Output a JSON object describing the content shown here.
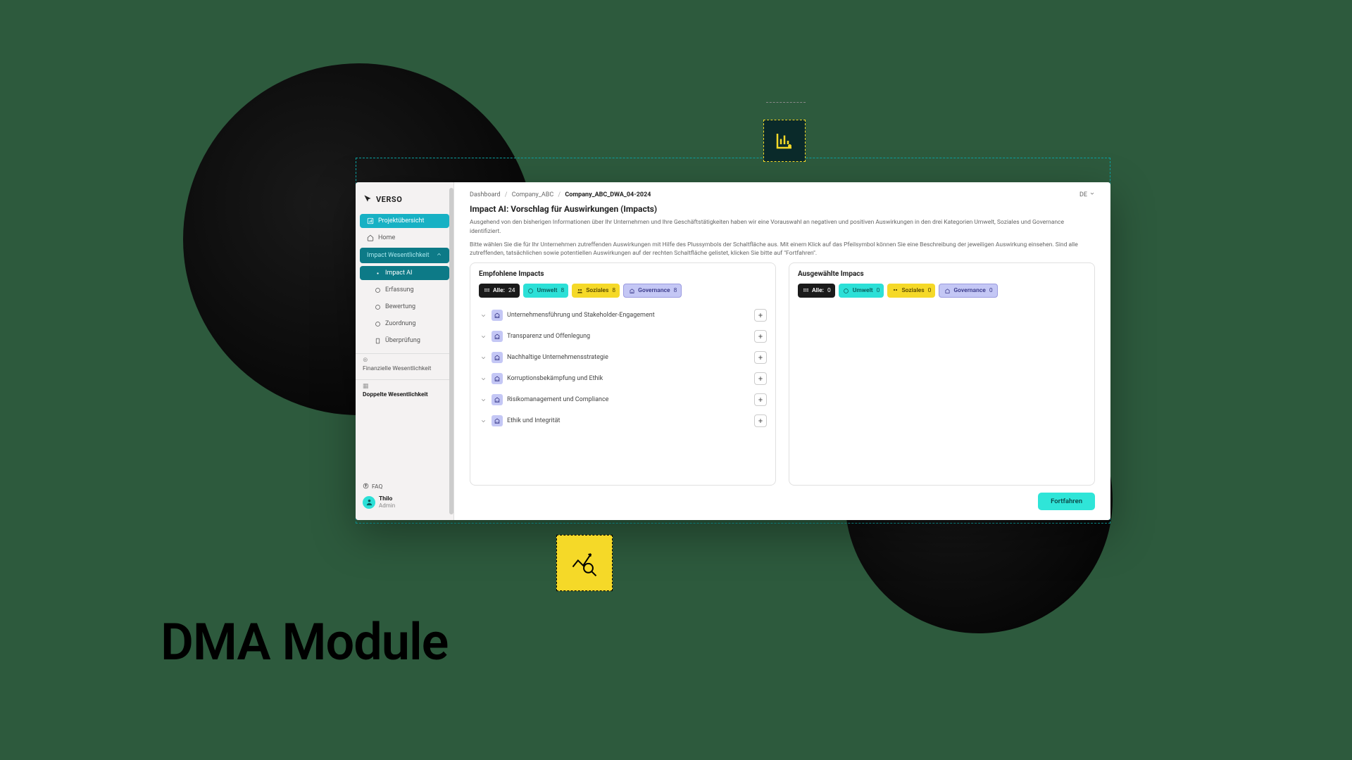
{
  "marketing_title": "DMA Module",
  "logo_text": "VERSO",
  "breadcrumbs": {
    "items": [
      "Dashboard",
      "Company_ABC",
      "Company_ABC_DWA_04-2024"
    ]
  },
  "language": "DE",
  "sidebar": {
    "projektubersicht": "Projektübersicht",
    "home": "Home",
    "impact_group": "Impact Wesentlichkeit",
    "impact_ai": "Impact AI",
    "erfassung": "Erfassung",
    "bewertung": "Bewertung",
    "zuordnung": "Zuordnung",
    "uberprufung": "Überprüfung",
    "fin_section": "Finanzielle Wesentlichkeit",
    "dopp_section": "Doppelte Wesentlichkeit",
    "faq": "FAQ",
    "user_name": "Thilo",
    "user_role": "Admin"
  },
  "page": {
    "title": "Impact AI: Vorschlag für Auswirkungen (Impacts)",
    "desc1": "Ausgehend von den bisherigen Informationen über Ihr Unternehmen und Ihre Geschäftstätigkeiten haben wir eine Vorauswahl an negativen und positiven Auswirkungen in den drei Kategorien Umwelt, Soziales und Governance identifiziert.",
    "desc2": "Bitte wählen Sie die für Ihr Unternehmen zutreffenden Auswirkungen mit Hilfe des Plussymbols der Schaltfläche aus. Mit einem Klick auf das Pfeilsymbol können Sie eine Beschreibung der jeweiligen Auswirkung einsehen. Sind alle zutreffenden, tatsächlichen sowie potentiellen Auswirkungen auf der rechten Schaltfläche gelistet, klicken Sie bitte auf \"Fortfahren\"."
  },
  "panels": {
    "left_title": "Empfohlene Impacts",
    "right_title": "Ausgewählte Impacs",
    "filters_left": {
      "all_label": "Alle:",
      "all_count": "24",
      "env_label": "Umwelt",
      "env_count": "8",
      "soc_label": "Soziales",
      "soc_count": "8",
      "gov_label": "Governance",
      "gov_count": "8"
    },
    "filters_right": {
      "all_label": "Alle:",
      "all_count": "0",
      "env_label": "Umwelt",
      "env_count": "0",
      "soc_label": "Soziales",
      "soc_count": "0",
      "gov_label": "Governance",
      "gov_count": "0"
    },
    "impacts": [
      "Unternehmensführung und Stakeholder-Engagement",
      "Transparenz und Offenlegung",
      "Nachhaltige Unternehmensstrategie",
      "Korruptionsbekämpfung und Ethik",
      "Risikomanagement und Compliance",
      "Ethik und Integrität"
    ]
  },
  "continue_label": "Fortfahren"
}
